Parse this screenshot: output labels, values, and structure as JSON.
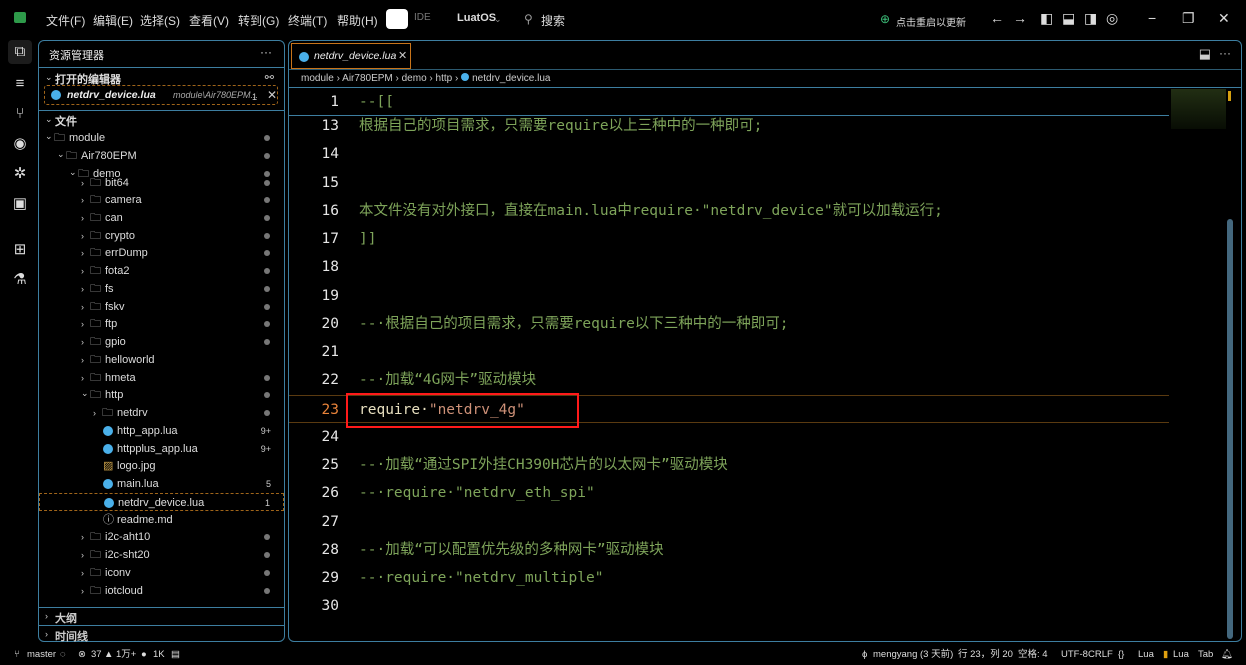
{
  "titlebar": {
    "menus": [
      "文件(F)",
      "编辑(E)",
      "选择(S)",
      "查看(V)",
      "转到(G)",
      "终端(T)",
      "帮助(H)"
    ],
    "ide_label": "IDE",
    "profile": "LuatOS",
    "search": "搜索",
    "update": "点击重启以更新"
  },
  "sidebar": {
    "title": "资源管理器",
    "more": "···",
    "open_editors": "打开的编辑器",
    "open_file": {
      "name": "netdrv_device.lua",
      "path": "module\\Air780EPM...",
      "badge": "1"
    },
    "files_section": "文件",
    "tree": [
      {
        "label": "module",
        "depth": 0,
        "type": "folder-open",
        "badge": "dot"
      },
      {
        "label": "Air780EPM",
        "depth": 1,
        "type": "folder-open",
        "badge": "dot"
      },
      {
        "label": "demo",
        "depth": 2,
        "type": "folder-open",
        "badge": "dot"
      },
      {
        "label": "bit64",
        "depth": 3,
        "type": "folder",
        "badge": "dot"
      },
      {
        "label": "camera",
        "depth": 3,
        "type": "folder",
        "badge": "dot"
      },
      {
        "label": "can",
        "depth": 3,
        "type": "folder",
        "badge": "dot"
      },
      {
        "label": "crypto",
        "depth": 3,
        "type": "folder",
        "badge": "dot"
      },
      {
        "label": "errDump",
        "depth": 3,
        "type": "folder",
        "badge": "dot"
      },
      {
        "label": "fota2",
        "depth": 3,
        "type": "folder",
        "badge": "dot"
      },
      {
        "label": "fs",
        "depth": 3,
        "type": "folder",
        "badge": "dot"
      },
      {
        "label": "fskv",
        "depth": 3,
        "type": "folder",
        "badge": "dot"
      },
      {
        "label": "ftp",
        "depth": 3,
        "type": "folder",
        "badge": "dot"
      },
      {
        "label": "gpio",
        "depth": 3,
        "type": "folder",
        "badge": "dot"
      },
      {
        "label": "helloworld",
        "depth": 3,
        "type": "folder",
        "badge": ""
      },
      {
        "label": "hmeta",
        "depth": 3,
        "type": "folder",
        "badge": "dot"
      },
      {
        "label": "http",
        "depth": 3,
        "type": "folder-open",
        "badge": "dot"
      },
      {
        "label": "netdrv",
        "depth": 4,
        "type": "folder",
        "badge": "dot"
      },
      {
        "label": "http_app.lua",
        "depth": 4,
        "type": "lua",
        "badge": "9+"
      },
      {
        "label": "httpplus_app.lua",
        "depth": 4,
        "type": "lua",
        "badge": "9+"
      },
      {
        "label": "logo.jpg",
        "depth": 4,
        "type": "image",
        "badge": ""
      },
      {
        "label": "main.lua",
        "depth": 4,
        "type": "lua",
        "badge": "5"
      },
      {
        "label": "netdrv_device.lua",
        "depth": 4,
        "type": "lua",
        "badge": "1",
        "selected": true
      },
      {
        "label": "readme.md",
        "depth": 4,
        "type": "info",
        "badge": ""
      },
      {
        "label": "i2c-aht10",
        "depth": 3,
        "type": "folder",
        "badge": "dot"
      },
      {
        "label": "i2c-sht20",
        "depth": 3,
        "type": "folder",
        "badge": "dot"
      },
      {
        "label": "iconv",
        "depth": 3,
        "type": "folder",
        "badge": "dot"
      },
      {
        "label": "iotcloud",
        "depth": 3,
        "type": "folder",
        "badge": "dot"
      }
    ],
    "outline": "大纲",
    "timeline": "时间线"
  },
  "editor": {
    "tab": "netdrv_device.lua",
    "breadcrumb": [
      "module",
      "Air780EPM",
      "demo",
      "http",
      "netdrv_device.lua"
    ],
    "sticky": {
      "n": "1",
      "text": "--[["
    },
    "lines": [
      {
        "n": "13",
        "text": "根据自己的项目需求，只需要require以上三种中的一种即可;"
      },
      {
        "n": "14",
        "text": ""
      },
      {
        "n": "15",
        "text": ""
      },
      {
        "n": "16",
        "text": "本文件没有对外接口，直接在main.lua中require·\"netdrv_device\"就可以加载运行;"
      },
      {
        "n": "17",
        "text": "]]"
      },
      {
        "n": "18",
        "text": ""
      },
      {
        "n": "19",
        "text": ""
      },
      {
        "n": "20",
        "text": "--·根据自己的项目需求，只需要require以下三种中的一种即可;"
      },
      {
        "n": "21",
        "text": ""
      },
      {
        "n": "22",
        "text": "--·加载“4G网卡”驱动模块"
      },
      {
        "n": "23",
        "kw": "require·",
        "str": "\"netdrv_4g\""
      },
      {
        "n": "24",
        "text": ""
      },
      {
        "n": "25",
        "text": "--·加载“通过SPI外挂CH390H芯片的以太网卡”驱动模块"
      },
      {
        "n": "26",
        "text": "--·require·\"netdrv_eth_spi\""
      },
      {
        "n": "27",
        "text": ""
      },
      {
        "n": "28",
        "text": "--·加载“可以配置优先级的多种网卡”驱动模块"
      },
      {
        "n": "29",
        "text": "--·require·\"netdrv_multiple\""
      },
      {
        "n": "30",
        "text": ""
      }
    ]
  },
  "status": {
    "branch": "master",
    "errors": "37",
    "warnings": "1万+",
    "infos": "1K",
    "author": "mengyang (3 天前)",
    "position": "行 23，列 20",
    "spaces": "空格: 4",
    "encoding": "UTF-8",
    "eol": "CRLF",
    "lang": "Lua",
    "lua": "Lua",
    "tab": "Tab"
  },
  "colors": {
    "accent": "#3d7ea0",
    "highlight": "#ff1a1a",
    "comment": "#7ea45a",
    "string": "#ce9178"
  }
}
